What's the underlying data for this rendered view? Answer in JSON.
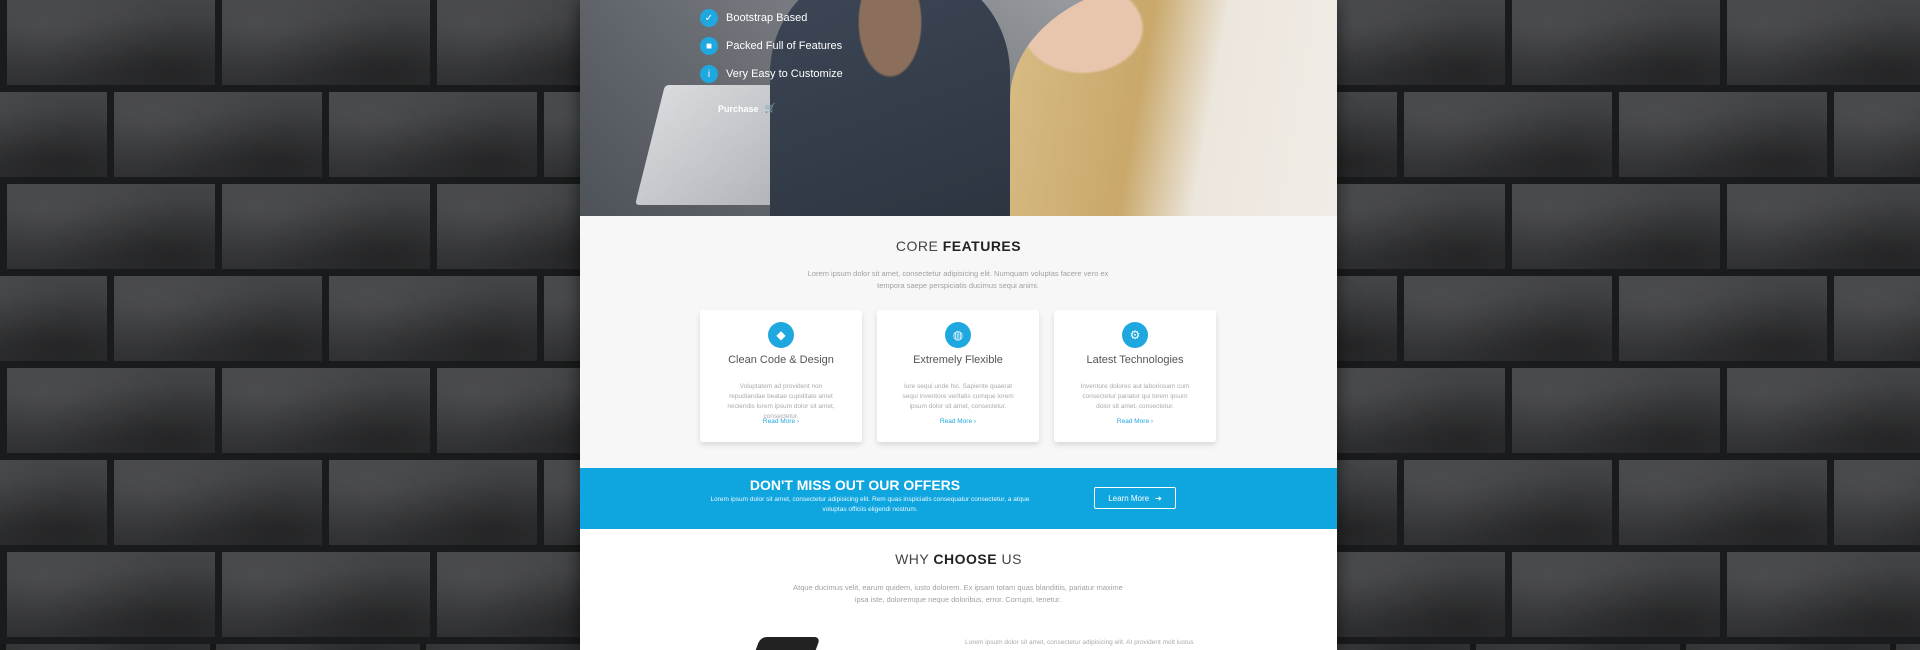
{
  "hero": {
    "features": [
      {
        "icon": "check-icon",
        "label": "Bootstrap Based"
      },
      {
        "icon": "box-icon",
        "label": "Packed Full of Features"
      },
      {
        "icon": "info-icon",
        "label": "Very Easy to Customize"
      }
    ],
    "purchase_label": "Purchase"
  },
  "core": {
    "title_light": "CORE ",
    "title_bold": "FEATURES",
    "subtitle": "Lorem ipsum dolor sit amet, consectetur adipisicing elit. Numquam voluptas facere vero ex tempora saepe perspiciatis ducimus sequi animi.",
    "cards": [
      {
        "icon": "diamond-icon",
        "title": "Clean Code & Design",
        "text": "Voluptatem ad provident non repudiandae beatae cupiditate amet reiciendis lorem ipsum dolor sit amet, consectetur.",
        "link": "Read More"
      },
      {
        "icon": "globe-icon",
        "title": "Extremely Flexible",
        "text": "Iure sequi unde hic. Sapiente quaerat sequi inventore veritatis cumque lorem ipsum dolor sit amet, consectetur.",
        "link": "Read More"
      },
      {
        "icon": "gear-icon",
        "title": "Latest Technologies",
        "text": "Inventore dolores aut laboriosam cum consectetur pariatur qui lorem ipsum dolor sit amet, consectetur.",
        "link": "Read More"
      }
    ]
  },
  "offers": {
    "title": "DON'T MISS OUT OUR OFFERS",
    "text": "Lorem ipsum dolor sit amet, consectetur adipisicing elit. Rem quas inspiciatis consequatur consectetur, a atque voluptas officiis eligendi nostrum.",
    "button_label": "Learn More"
  },
  "why": {
    "title_light": "WHY ",
    "title_bold": "CHOOSE",
    "title_end": " US",
    "subtitle": "Atque ducimus velit, earum quidem, iusto dolorem. Ex ipsam totam quas blanditiis, pariatur maxime ipsa iste, doloremque neque doloribus, error. Corrupti, tenetur.",
    "text": "Lorem ipsum dolor sit amet, consectetur adipisicing elit. At provident molt iustus"
  },
  "colors": {
    "accent": "#0fa6e0",
    "card_bg": "#ffffff",
    "section_bg": "#f7f7f7"
  }
}
